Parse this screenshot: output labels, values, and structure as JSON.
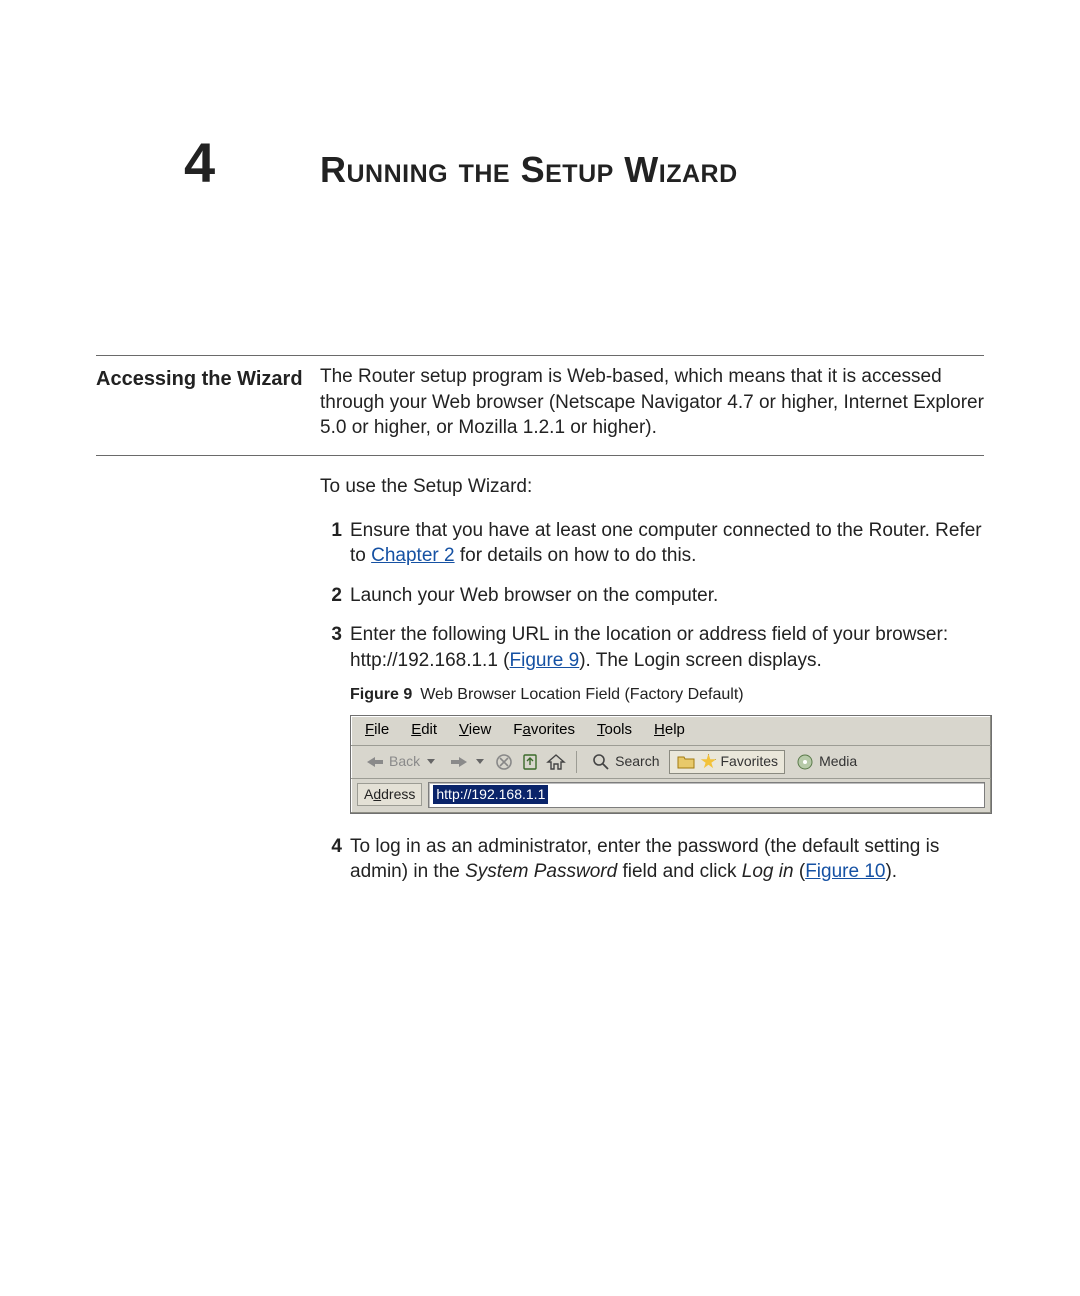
{
  "chapter": {
    "number": "4",
    "title": "Running the Setup Wizard"
  },
  "section": {
    "heading": "Accessing the Wizard",
    "intro": "The Router setup program is Web-based, which means that it is accessed through your Web browser (Netscape Navigator 4.7 or higher, Internet Explorer 5.0 or higher, or Mozilla 1.2.1 or higher).",
    "lead": "To use the Setup Wizard:",
    "step1_a": "Ensure that you have at least one computer connected to the Router. Refer to ",
    "step1_link": "Chapter 2",
    "step1_b": " for details on how to do this.",
    "step2": "Launch your Web browser on the computer.",
    "step3_a": "Enter the following URL in the location or address field of your browser: ",
    "step3_url": "http://192.168.1.1",
    "step3_b": " (",
    "step3_link": "Figure 9",
    "step3_c": "). The Login screen displays.",
    "fig_label": "Figure 9",
    "fig_title": "Web Browser Location Field (Factory Default)",
    "step4_a": "To log in as an administrator, enter the password (the default setting is ",
    "step4_pw": "admin",
    "step4_b": ") in the ",
    "step4_field": "System Password",
    "step4_c": " field and click ",
    "step4_btn": "Log in",
    "step4_d": " (",
    "step4_link": "Figure 10",
    "step4_e": ")."
  },
  "browser": {
    "menus": {
      "file": "File",
      "edit": "Edit",
      "view": "View",
      "favorites": "Favorites",
      "tools": "Tools",
      "help": "Help"
    },
    "back": "Back",
    "search": "Search",
    "favorites_btn": "Favorites",
    "media": "Media",
    "address_label": "Address",
    "address_value": "http://192.168.1.1"
  }
}
